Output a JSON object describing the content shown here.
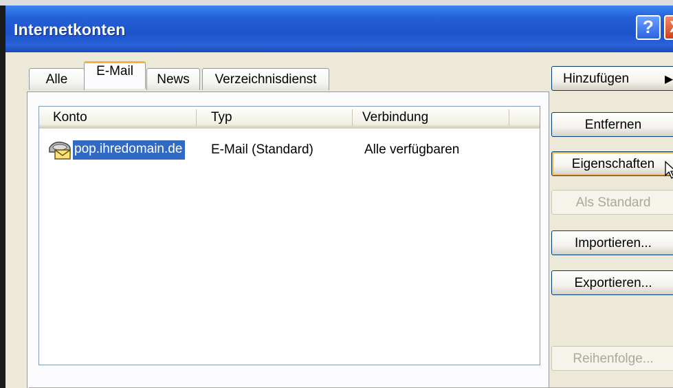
{
  "window": {
    "title": "Internetkonten"
  },
  "titlebar_buttons": {
    "help": "?",
    "close": "X"
  },
  "tabs": [
    {
      "label": "Alle"
    },
    {
      "label": "E-Mail",
      "active": true
    },
    {
      "label": "News"
    },
    {
      "label": "Verzeichnisdienst"
    }
  ],
  "accounts": {
    "columns": [
      "Konto",
      "Typ",
      "Verbindung"
    ],
    "rows": [
      {
        "konto": "pop.ihredomain.de",
        "typ": "E-Mail (Standard)",
        "verbindung": "Alle verfügbaren",
        "selected": true,
        "icon": "mail-account-icon"
      }
    ]
  },
  "buttons": {
    "add": "Hinzufügen",
    "remove": "Entfernen",
    "properties": "Eigenschaften",
    "set_default": "Als Standard",
    "import": "Importieren...",
    "export": "Exportieren...",
    "order": "Reihenfolge..."
  },
  "colors": {
    "titlebar": "#2460d8",
    "selection": "#316ac5",
    "active_tab_accent": "#f6b03a"
  }
}
